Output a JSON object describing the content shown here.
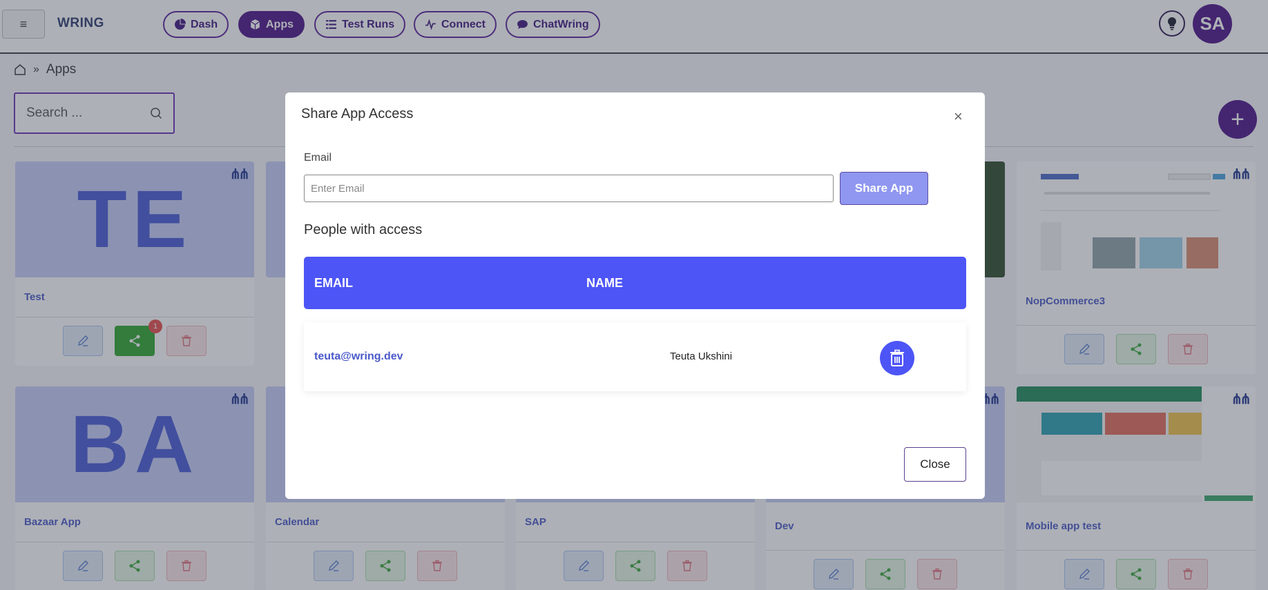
{
  "app": {
    "brand": "WRING",
    "avatar_initials": "SA"
  },
  "nav": [
    {
      "label": "Dash",
      "icon": "pie-chart-icon",
      "active": false
    },
    {
      "label": "Apps",
      "icon": "cube-icon",
      "active": true
    },
    {
      "label": "Test Runs",
      "icon": "list-icon",
      "active": false
    },
    {
      "label": "Connect",
      "icon": "pulse-icon",
      "active": false
    },
    {
      "label": "ChatWring",
      "icon": "chat-bubble-icon",
      "active": false
    }
  ],
  "breadcrumb": {
    "current": "Apps"
  },
  "search": {
    "placeholder": "Search ..."
  },
  "cards": [
    {
      "title": "Test",
      "thumb_text": "TE",
      "share_active": true,
      "badge": "1"
    },
    {
      "title": "NopCommerce3",
      "thumb_text": "",
      "share_active": false,
      "badge": ""
    },
    {
      "title": "Bazaar App",
      "thumb_text": "BA",
      "share_active": false,
      "badge": ""
    },
    {
      "title": "Calendar",
      "thumb_text": "",
      "share_active": false,
      "badge": ""
    },
    {
      "title": "SAP",
      "thumb_text": "",
      "share_active": false,
      "badge": ""
    },
    {
      "title": "Dev",
      "thumb_text": "",
      "share_active": false,
      "badge": ""
    },
    {
      "title": "Mobile app test",
      "thumb_text": "",
      "share_active": false,
      "badge": ""
    }
  ],
  "modal": {
    "title": "Share App Access",
    "close_x": "×",
    "email_label": "Email",
    "email_placeholder": "Enter Email",
    "share_button": "Share App",
    "people_heading": "People with access",
    "columns": [
      "EMAIL",
      "NAME"
    ],
    "rows": [
      {
        "email": "teuta@wring.dev",
        "name": "Teuta Ukshini"
      }
    ],
    "close_button": "Close"
  },
  "colors": {
    "brand_purple": "#4a1087",
    "table_header": "#4d55f6",
    "share_button": "#8f97f0",
    "share_active_green": "#2ea52e"
  }
}
